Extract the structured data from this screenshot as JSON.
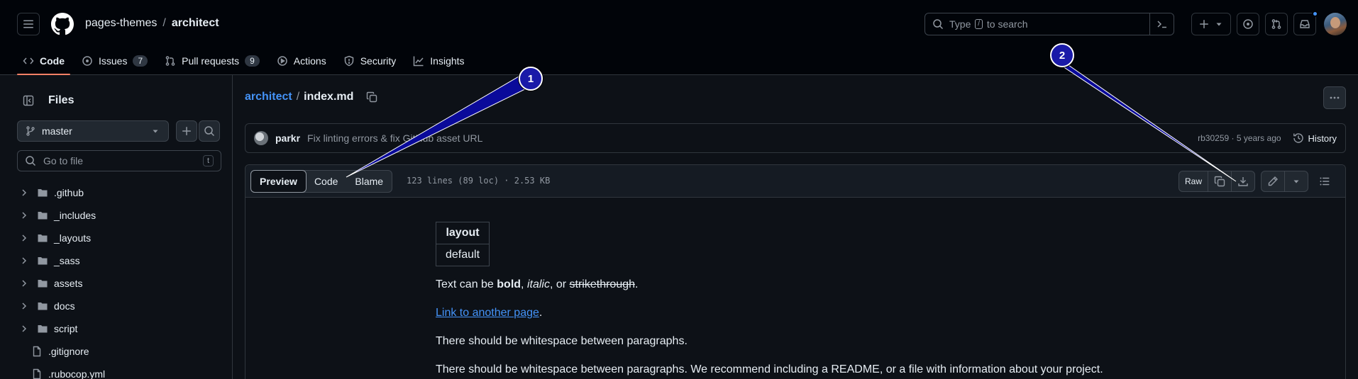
{
  "header": {
    "owner": "pages-themes",
    "separator": "/",
    "repo": "architect",
    "search_text_before": "Type",
    "search_key": "/",
    "search_text_after": "to search"
  },
  "repo_nav": [
    {
      "label": "Code",
      "icon": "code-icon",
      "count": "",
      "active": true
    },
    {
      "label": "Issues",
      "icon": "issue-icon",
      "count": "7"
    },
    {
      "label": "Pull requests",
      "icon": "git-pull-request-icon",
      "count": "9"
    },
    {
      "label": "Actions",
      "icon": "play-icon",
      "count": ""
    },
    {
      "label": "Security",
      "icon": "shield-icon",
      "count": ""
    },
    {
      "label": "Insights",
      "icon": "graph-icon",
      "count": ""
    }
  ],
  "sidebar": {
    "title": "Files",
    "branch": "master",
    "goto_placeholder": "Go to file",
    "goto_key": "t",
    "tree": [
      {
        "name": ".github",
        "type": "dir"
      },
      {
        "name": "_includes",
        "type": "dir"
      },
      {
        "name": "_layouts",
        "type": "dir"
      },
      {
        "name": "_sass",
        "type": "dir"
      },
      {
        "name": "assets",
        "type": "dir"
      },
      {
        "name": "docs",
        "type": "dir"
      },
      {
        "name": "script",
        "type": "dir"
      },
      {
        "name": ".gitignore",
        "type": "file"
      },
      {
        "name": ".rubocop.yml",
        "type": "file"
      }
    ]
  },
  "main": {
    "path_dir": "architect",
    "path_sep": "/",
    "path_file": "index.md",
    "commit_author": "parkr",
    "commit_message": "Fix linting errors & fix GitHub asset URL",
    "commit_meta": "rb30259 · 5 years ago",
    "history_label": "History",
    "view_tabs": [
      "Preview",
      "Code",
      "Blame"
    ],
    "file_meta": "123 lines (89 loc) · 2.53 KB",
    "raw_label": "Raw"
  },
  "markdown": {
    "table_header": "layout",
    "table_value": "default",
    "p1_pre": "Text can be ",
    "p1_bold": "bold",
    "p1_mid1": ", ",
    "p1_italic": "italic",
    "p1_mid2": ", or ",
    "p1_strike": "strikethrough",
    "p1_end": ".",
    "link_text": "Link to another page",
    "link_end": ".",
    "p3": "There should be whitespace between paragraphs.",
    "p4": "There should be whitespace between paragraphs. We recommend including a README, or a file with information about your project."
  },
  "annotations": [
    "1",
    "2"
  ],
  "colors": {
    "accent": "#4493f8",
    "tab_underline": "#f78166",
    "annotation": "#1a1aa8"
  }
}
